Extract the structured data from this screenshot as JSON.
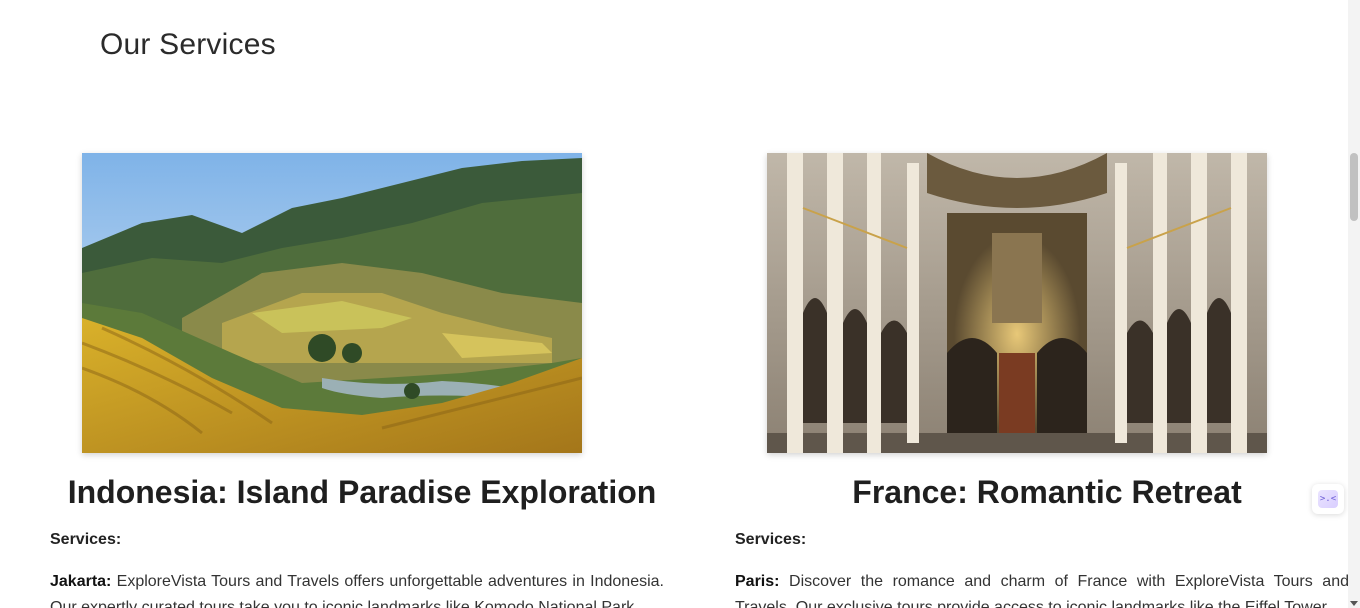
{
  "section": {
    "title": "Our Services"
  },
  "cards": [
    {
      "image_alt": "Rice terraces in mountain valley",
      "title": "Indonesia: Island Paradise Exploration",
      "services_label": "Services:",
      "highlight": "Jakarta:",
      "text": " ExploreVista Tours and Travels offers unforgettable adventures in Indonesia. Our expertly curated tours take you to iconic landmarks like Komodo National Park"
    },
    {
      "image_alt": "Ornate palace chapel interior",
      "title": "France: Romantic Retreat",
      "services_label": "Services:",
      "highlight": "Paris:",
      "text": " Discover the romance and charm of France with ExploreVista Tours and Travels. Our exclusive tours provide access to iconic landmarks like the Eiffel Tower"
    }
  ],
  "widget": {
    "icon": "chat-assistant-icon",
    "glyph": ">.<"
  },
  "colors": {
    "background": "#ffffff",
    "title_text": "#1f1f1f",
    "body_text": "#333333",
    "widget_accent": "#6b5bd6"
  }
}
